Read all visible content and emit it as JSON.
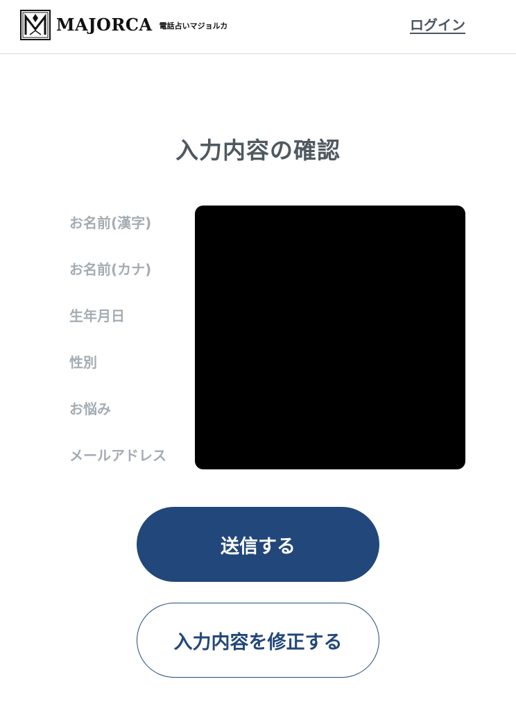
{
  "header": {
    "brand_name": "MAJORCA",
    "brand_subtitle": "電話占いマジョルカ",
    "login_label": "ログイン",
    "logo_icon": "majorca-m-logo-icon"
  },
  "page": {
    "title": "入力内容の確認"
  },
  "form": {
    "fields": [
      {
        "label": "お名前(漢字)"
      },
      {
        "label": "お名前(カナ)"
      },
      {
        "label": "生年月日"
      },
      {
        "label": "性別"
      },
      {
        "label": "お悩み"
      },
      {
        "label": "メールアドレス"
      }
    ]
  },
  "actions": {
    "submit_label": "送信する",
    "edit_label": "入力内容を修正する"
  },
  "colors": {
    "primary": "#22477a",
    "label": "#a4acb3",
    "title": "#505860",
    "link": "#4a5561"
  }
}
